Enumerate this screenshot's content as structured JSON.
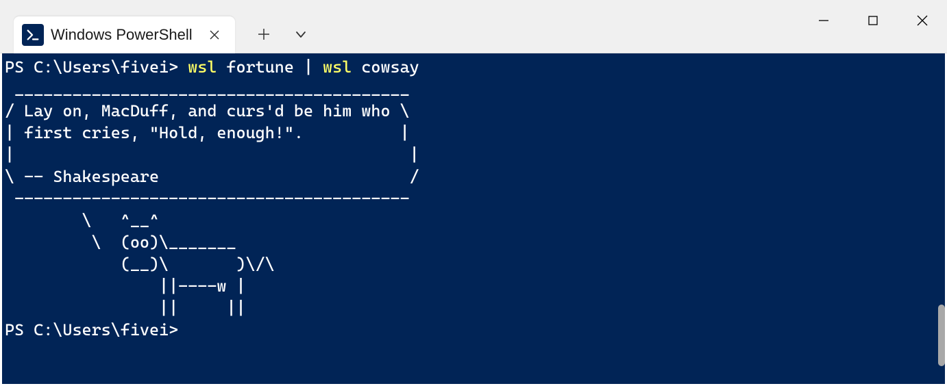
{
  "tab": {
    "title": "Windows PowerShell"
  },
  "terminal": {
    "prompt1": "PS C:\\Users\\fivei> ",
    "cmd1_part1": "wsl",
    "cmd1_part2": " fortune | ",
    "cmd1_part3": "wsl",
    "cmd1_part4": " cowsay",
    "output": " _________________________________________\n/ Lay on, MacDuff, and curs'd be him who \\\n| first cries, \"Hold, enough!\".          |\n|                                         |\n\\ -- Shakespeare                          /\n -----------------------------------------\n        \\   ^__^\n         \\  (oo)\\_______\n            (__)\\       )\\/\\\n                ||----w |\n                ||     ||",
    "prompt2": "PS C:\\Users\\fivei>"
  }
}
